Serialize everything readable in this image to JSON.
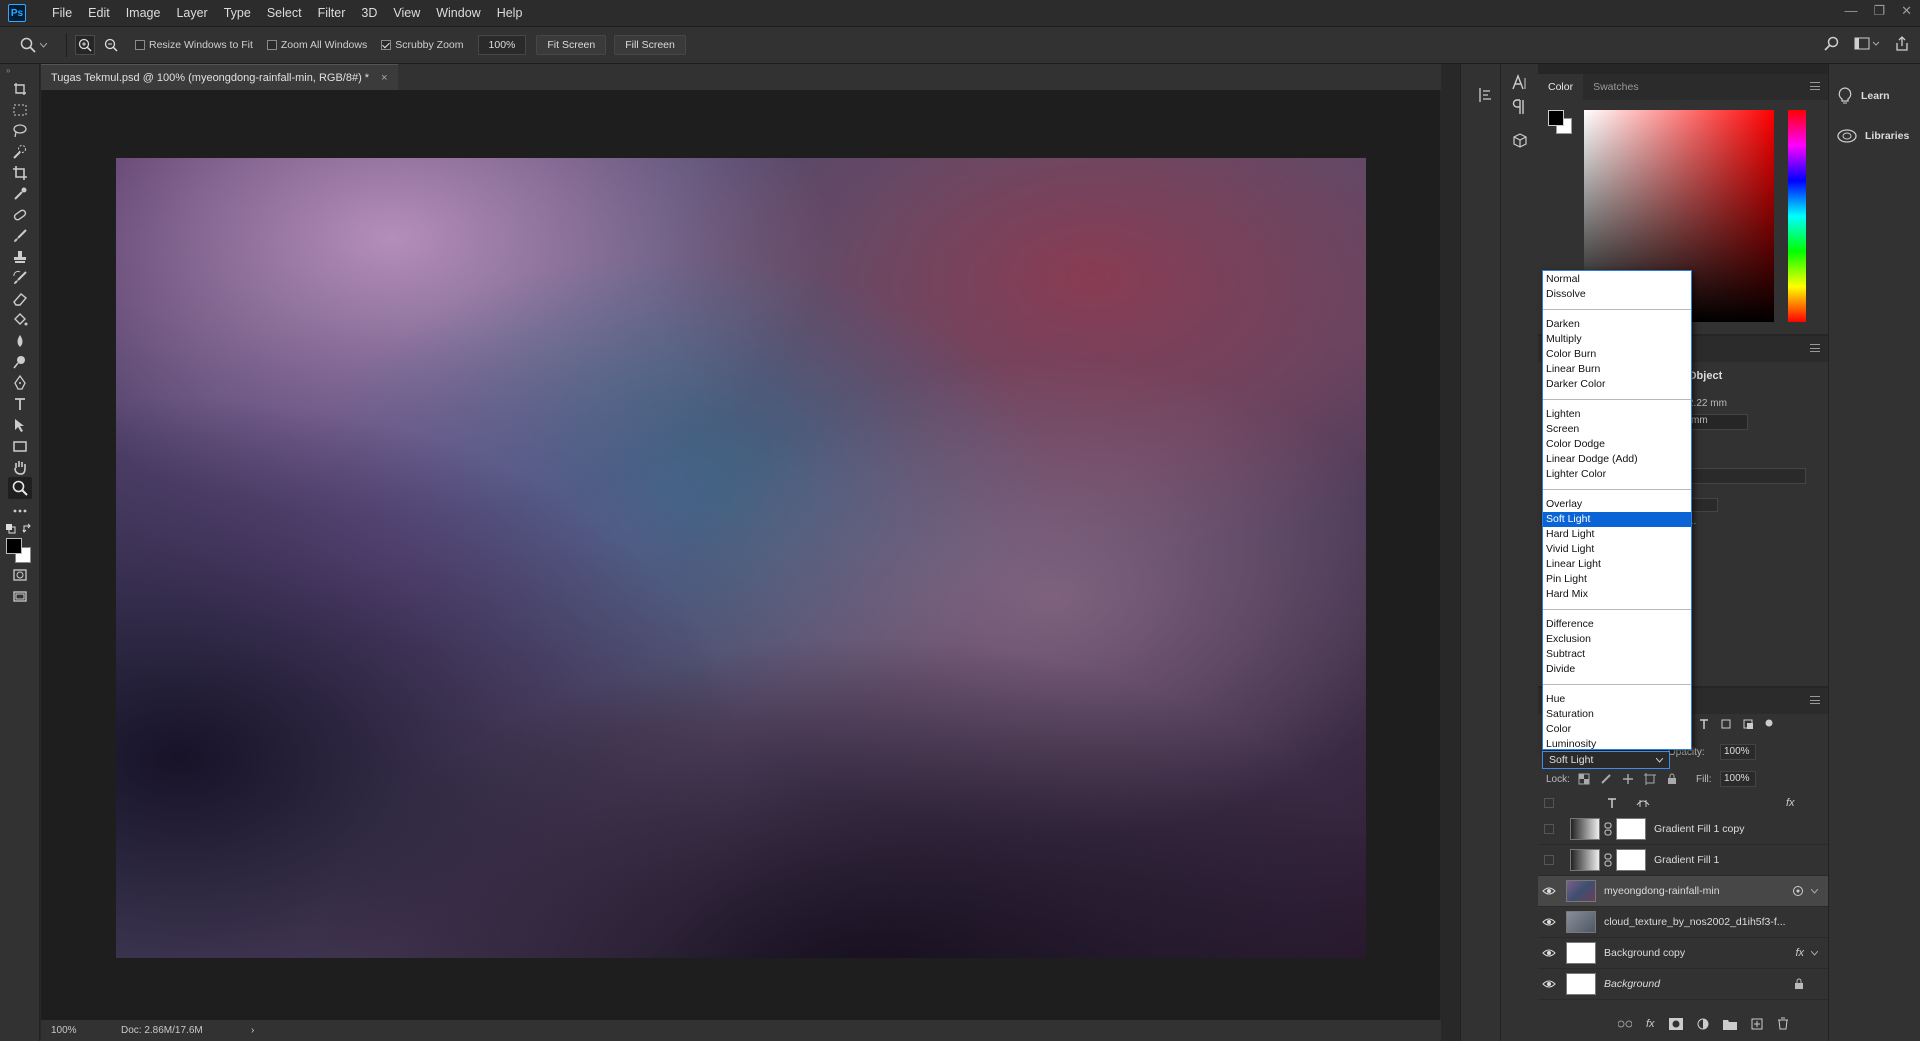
{
  "app": {
    "logo": "Ps"
  },
  "menu": [
    "File",
    "Edit",
    "Image",
    "Layer",
    "Type",
    "Select",
    "Filter",
    "3D",
    "View",
    "Window",
    "Help"
  ],
  "options_bar": {
    "resize_windows": "Resize Windows to Fit",
    "zoom_all": "Zoom All Windows",
    "scrubby_zoom": "Scrubby Zoom",
    "zoom_value": "100%",
    "fit_screen": "Fit Screen",
    "fill_screen": "Fill Screen"
  },
  "document": {
    "tab_title": "Tugas Tekmul.psd @ 100% (myeongdong-rainfall-min, RGB/8#) *",
    "close_glyph": "×"
  },
  "status": {
    "zoom": "100%",
    "doc": "Doc: 2.86M/17.6M",
    "arrow": "›"
  },
  "color_panel": {
    "tabs": [
      "Color",
      "Swatches"
    ]
  },
  "learn_panel": {
    "learn": "Learn",
    "libraries": "Libraries"
  },
  "properties_panel": {
    "label_object": "Object",
    "value_mm_1": "2.22 mm",
    "value_mm_2": "mm",
    "ellipsis": "..."
  },
  "blend_modes": {
    "groups": [
      [
        "Normal",
        "Dissolve"
      ],
      [
        "Darken",
        "Multiply",
        "Color Burn",
        "Linear Burn",
        "Darker Color"
      ],
      [
        "Lighten",
        "Screen",
        "Color Dodge",
        "Linear Dodge (Add)",
        "Lighter Color"
      ],
      [
        "Overlay",
        "Soft Light",
        "Hard Light",
        "Vivid Light",
        "Linear Light",
        "Pin Light",
        "Hard Mix"
      ],
      [
        "Difference",
        "Exclusion",
        "Subtract",
        "Divide"
      ],
      [
        "Hue",
        "Saturation",
        "Color",
        "Luminosity"
      ]
    ],
    "selected": "Soft Light"
  },
  "layers_panel": {
    "blend_mode": "Soft Light",
    "opacity_label": "Opacity:",
    "opacity_value": "100%",
    "lock_label": "Lock:",
    "fill_label": "Fill:",
    "fill_value": "100%",
    "fx": "fx",
    "layers": [
      {
        "name": "Gradient Fill 1 copy",
        "visible": false
      },
      {
        "name": "Gradient Fill 1",
        "visible": false
      },
      {
        "name": "myeongdong-rainfall-min",
        "visible": true,
        "selected": true
      },
      {
        "name": "cloud_texture_by_nos2002_d1ih5f3-f...",
        "visible": true
      },
      {
        "name": "Background copy",
        "visible": true
      },
      {
        "name": "Background",
        "visible": true,
        "locked": true
      }
    ]
  },
  "colors": {
    "accent": "#0a64d6",
    "bg": "#282828",
    "panel": "#323232"
  }
}
